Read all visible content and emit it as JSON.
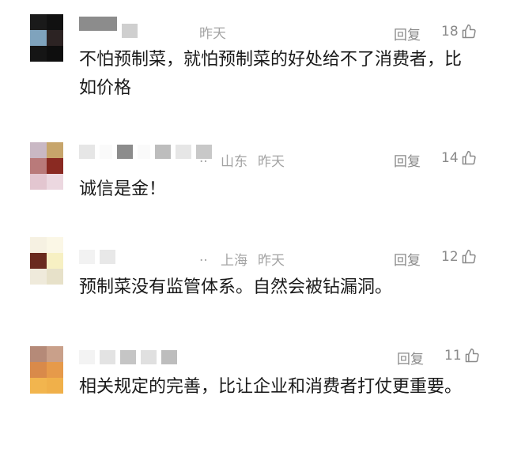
{
  "comments": [
    {
      "location": "",
      "time": "昨天",
      "reply_label": "回复",
      "likes": "18",
      "text": "不怕预制菜，就怕预制菜的好处给不了消费者，比如价格"
    },
    {
      "location": "山东",
      "time": "昨天",
      "reply_label": "回复",
      "likes": "14",
      "text": "诚信是金！"
    },
    {
      "location": "上海",
      "time": "昨天",
      "reply_label": "回复",
      "likes": "12",
      "text": "预制菜没有监管体系。自然会被钻漏洞。"
    },
    {
      "location": "",
      "time": "",
      "reply_label": "回复",
      "likes": "11",
      "text": "相关规定的完善，比让企业和消费者打仗更重要。"
    }
  ],
  "icons": {
    "like": "thumbs-up-icon",
    "more": "ellipsis-icon"
  }
}
